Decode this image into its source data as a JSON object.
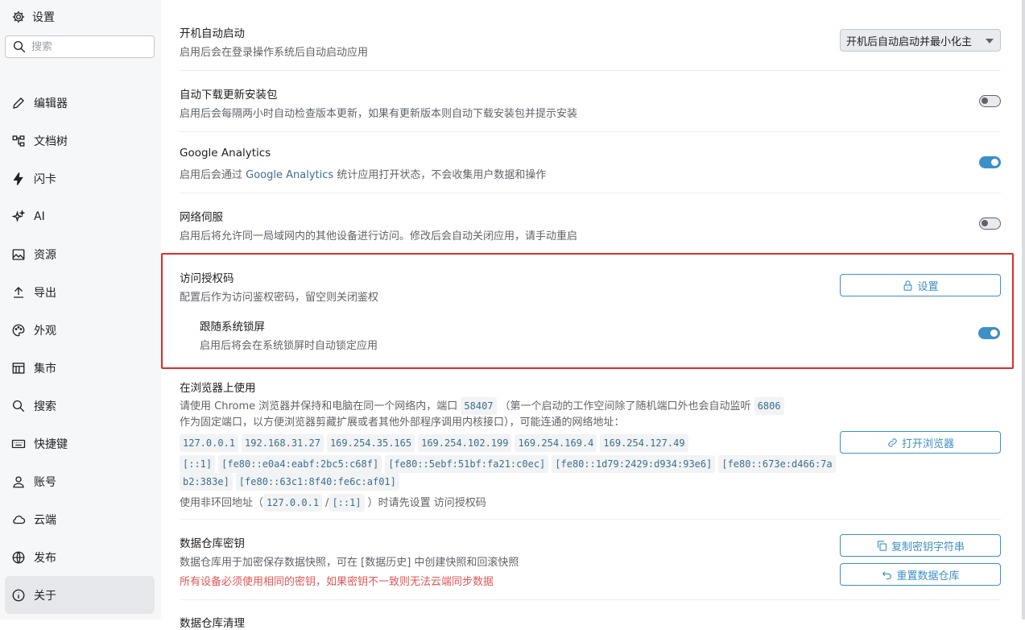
{
  "sidebar": {
    "title": "设置",
    "search_placeholder": "搜索",
    "items": [
      {
        "label": "编辑器",
        "icon": "pencil-icon"
      },
      {
        "label": "文档树",
        "icon": "tree-icon"
      },
      {
        "label": "闪卡",
        "icon": "flash-icon"
      },
      {
        "label": "AI",
        "icon": "sparkle-icon"
      },
      {
        "label": "资源",
        "icon": "image-icon"
      },
      {
        "label": "导出",
        "icon": "upload-icon"
      },
      {
        "label": "外观",
        "icon": "palette-icon"
      },
      {
        "label": "集市",
        "icon": "store-icon"
      },
      {
        "label": "搜索",
        "icon": "search-icon"
      },
      {
        "label": "快捷键",
        "icon": "keyboard-icon"
      },
      {
        "label": "账号",
        "icon": "user-icon"
      },
      {
        "label": "云端",
        "icon": "cloud-icon"
      },
      {
        "label": "发布",
        "icon": "globe-icon"
      },
      {
        "label": "关于",
        "icon": "info-icon",
        "active": true
      }
    ]
  },
  "settings": {
    "autostart": {
      "title": "开机自动启动",
      "desc": "启用后会在登录操作系统后自动启动应用",
      "value": "开机后自动启动并最小化主"
    },
    "autodownload": {
      "title": "自动下载更新安装包",
      "desc": "启用后会每隔两小时自动检查版本更新，如果有更新版本则自动下载安装包并提示安装",
      "enabled": false
    },
    "analytics": {
      "title": "Google Analytics",
      "desc_pre": "启用后会通过",
      "desc_link": "Google Analytics",
      "desc_post": "统计应用打开状态，不会收集用户数据和操作",
      "enabled": true
    },
    "network": {
      "title": "网络伺服",
      "desc": "启用后将允许同一局域网内的其他设备进行访问。修改后会自动关闭应用，请手动重启",
      "enabled": false
    },
    "authcode": {
      "title": "访问授权码",
      "desc": "配置后作为访问鉴权密码，留空则关闭鉴权",
      "button": "设置"
    },
    "lock": {
      "title": "跟随系统锁屏",
      "desc": "启用后将会在系统锁屏时自动锁定应用",
      "enabled": true
    },
    "browser": {
      "title": "在浏览器上使用",
      "line1_pre": "请使用 Chrome 浏览器并保持和电脑在同一个网络内，端口",
      "port": "58407",
      "line1_post": "（第一个启动的工作空间除了随机端口外也会自动监听",
      "fixed_port": "6806",
      "line2": "作为固定端口，以方便浏览器剪藏扩展或者其他外部程序调用内核接口），可能连通的网络地址：",
      "addresses_v4": [
        "127.0.0.1",
        "192.168.31.27",
        "169.254.35.165",
        "169.254.102.199",
        "169.254.169.4",
        "169.254.127.49"
      ],
      "addresses_v6": [
        "[::1]",
        "[fe80::e0a4:eabf:2bc5:c68f]",
        "[fe80::5ebf:51bf:fa21:c0ec]",
        "[fe80::1d79:2429:d934:93e6]",
        "[fe80::673e:d466:7a"
      ],
      "addresses_v6_b": [
        "b2:383e]",
        "[fe80::63c1:8f40:fe6c:af01]"
      ],
      "note_pre": "使用非环回地址（",
      "loop_v4": "127.0.0.1",
      "slash": "/",
      "loop_v6": "[::1]",
      "note_post": "）时请先设置 访问授权码",
      "button": "打开浏览器"
    },
    "repokey": {
      "title": "数据仓库密钥",
      "desc": "数据仓库用于加密保存数据快照，可在 [数据历史] 中创建快照和回滚快照",
      "warning": "所有设备必须使用相同的密钥，如果密钥不一致则无法云端同步数据",
      "copy_button": "复制密钥字符串",
      "reset_button": "重置数据仓库"
    },
    "next_title": "数据仓库清理"
  }
}
